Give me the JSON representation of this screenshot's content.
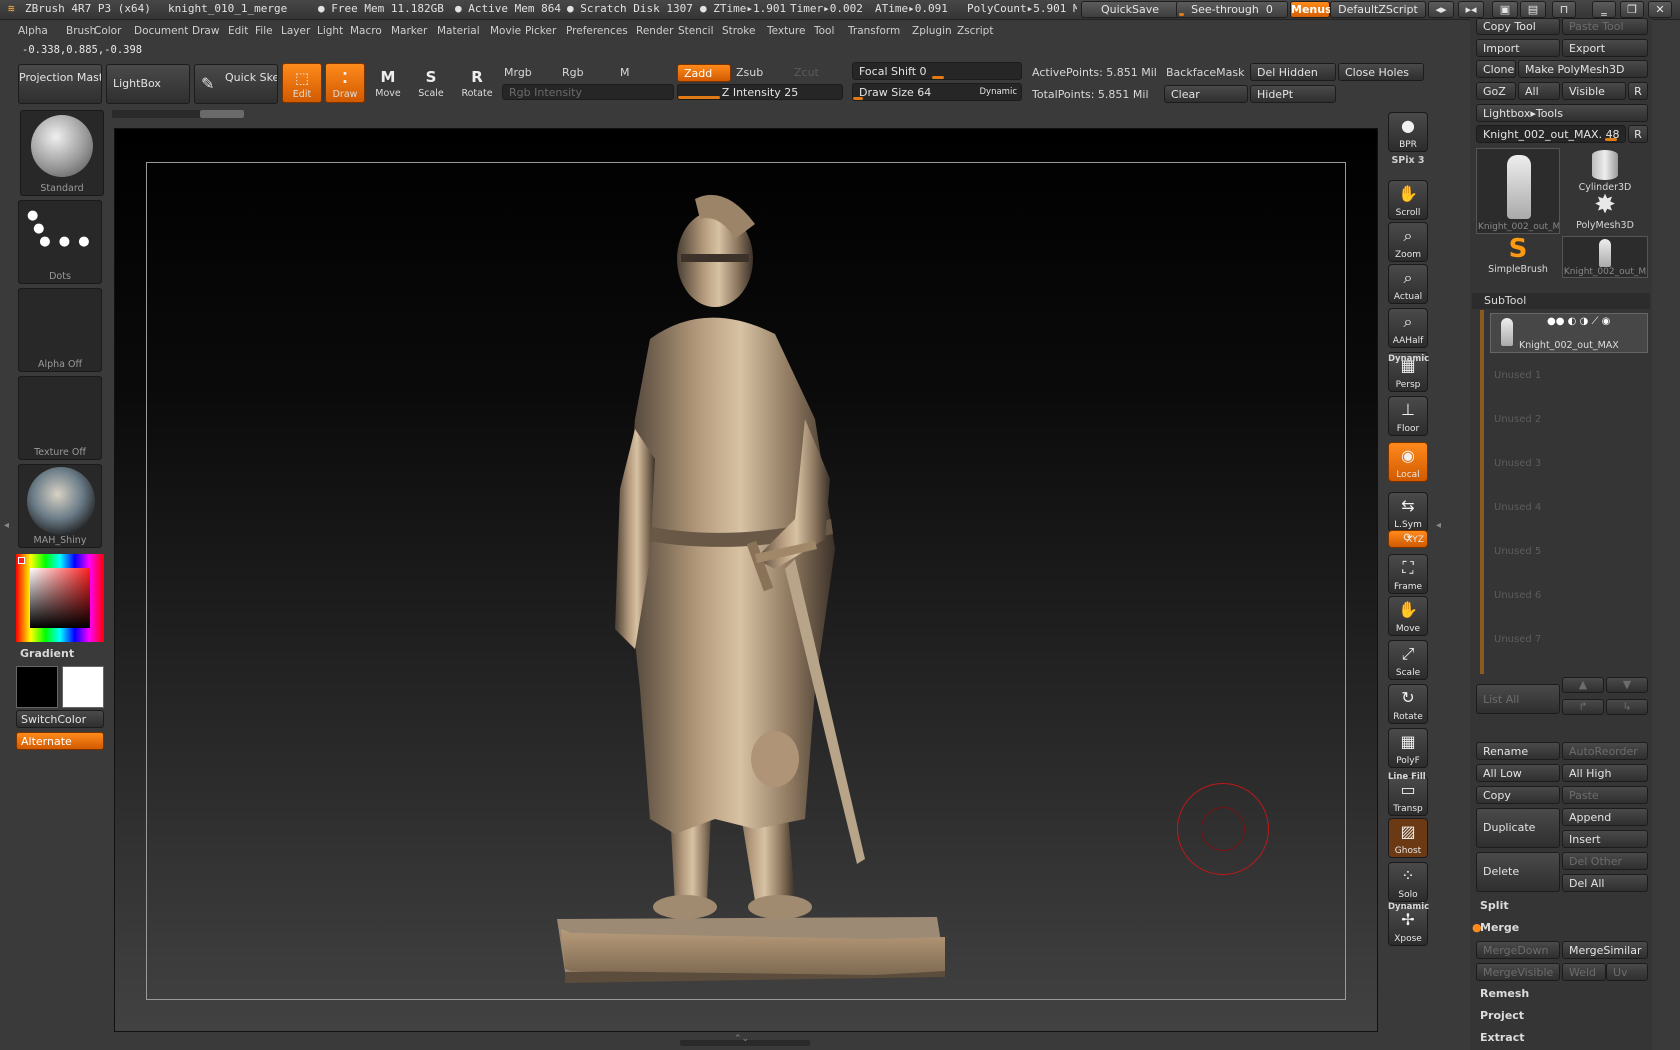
{
  "titlebar": {
    "app": "ZBrush 4R7 P3 (x64)",
    "document": "knight_010_1_merge",
    "free_mem": "● Free Mem 11.182GB",
    "active_mem": "● Active Mem 864",
    "scratch": "● Scratch Disk 1307",
    "ztime": "● ZTime▸1.901",
    "timer": "Timer▸0.002",
    "atime": "ATime▸0.091",
    "polycount": "PolyCount▸5.901 M",
    "quicksave": "QuickSave",
    "see_through_label": "See-through",
    "see_through_value": "0",
    "see_through_fraction": 0.05,
    "menus": "Menus",
    "script": "DefaultZScript"
  },
  "menubar": [
    "Alpha",
    "Brush",
    "Color",
    "Document",
    "Draw",
    "Edit",
    "File",
    "Layer",
    "Light",
    "Macro",
    "Marker",
    "Material",
    "Movie",
    "Picker",
    "Preferences",
    "Render",
    "Stencil",
    "Stroke",
    "Texture",
    "Tool",
    "Transform",
    "Zplugin",
    "Zscript"
  ],
  "coords": "-0.338,0.885,-0.398",
  "toolbar": {
    "projection_master": "Projection Master",
    "lightbox": "LightBox",
    "quick_sketch": "Quick Sketch",
    "edit": "Edit",
    "draw": "Draw",
    "move": "Move",
    "scale": "Scale",
    "rotate": "Rotate",
    "mrgb": "Mrgb",
    "rgb": "Rgb",
    "m": "M",
    "rgb_intensity": "Rgb Intensity",
    "zadd": "Zadd",
    "zsub": "Zsub",
    "zcut": "Zcut",
    "z_intensity": "Z Intensity 25",
    "z_intensity_fraction": 0.25,
    "focal_shift": "Focal Shift 0",
    "focal_shift_fraction": 0.5,
    "draw_size": "Draw Size 64",
    "draw_size_fraction": 0.06,
    "dynamic": "Dynamic",
    "active_points": "ActivePoints: 5.851 Mil",
    "total_points": "TotalPoints: 5.851 Mil",
    "backface_mask": "BackfaceMask",
    "del_hidden": "Del Hidden",
    "close_holes": "Close Holes",
    "clear": "Clear",
    "hidept": "HidePt"
  },
  "leftpanel": {
    "brush": "Standard",
    "stroke": "Dots",
    "alpha": "Alpha Off",
    "texture": "Texture Off",
    "material": "MAH_Shiny",
    "gradient": "Gradient",
    "switchcolor": "SwitchColor",
    "alternate": "Alternate",
    "main_color": "#000000",
    "secondary_color": "#ffffff"
  },
  "righttools": [
    {
      "name": "bpr",
      "label": "BPR",
      "icon": "bpr-sphere-icon",
      "state": "normal"
    },
    {
      "name": "spix",
      "label": "SPix 3",
      "icon": "",
      "state": "label"
    },
    {
      "name": "scroll",
      "label": "Scroll",
      "icon": "hand-icon",
      "state": "normal"
    },
    {
      "name": "zoom",
      "label": "Zoom",
      "icon": "magnifier-icon",
      "state": "normal"
    },
    {
      "name": "actual",
      "label": "Actual",
      "icon": "magnifier-icon",
      "state": "normal"
    },
    {
      "name": "aahalf",
      "label": "AAHalf",
      "icon": "magnifier-icon",
      "state": "normal"
    },
    {
      "name": "persp",
      "label": "Persp",
      "icon": "grid-icon",
      "state": "normal"
    },
    {
      "name": "floor",
      "label": "Floor",
      "icon": "floor-icon",
      "state": "normal"
    },
    {
      "name": "local",
      "label": "Local",
      "icon": "local-icon",
      "state": "active"
    },
    {
      "name": "lsym",
      "label": "L.Sym",
      "icon": "arrows-icon",
      "state": "normal"
    },
    {
      "name": "xyz",
      "label": "XYZ",
      "icon": "xyz-icon",
      "state": "active"
    },
    {
      "name": "frame",
      "label": "Frame",
      "icon": "frame-icon",
      "state": "normal"
    },
    {
      "name": "move",
      "label": "Move",
      "icon": "hand-icon",
      "state": "normal"
    },
    {
      "name": "scale",
      "label": "Scale",
      "icon": "scale-icon",
      "state": "normal"
    },
    {
      "name": "rotate",
      "label": "Rotate",
      "icon": "rotate-icon",
      "state": "normal"
    },
    {
      "name": "polyf",
      "label": "PolyF",
      "icon": "grid-icon",
      "state": "normal"
    },
    {
      "name": "transp",
      "label": "Transp",
      "icon": "transp-icon",
      "state": "normal"
    },
    {
      "name": "ghost",
      "label": "Ghost",
      "icon": "ghost-icon",
      "state": "brown"
    },
    {
      "name": "solo",
      "label": "Solo",
      "icon": "spheres-icon",
      "state": "normal"
    },
    {
      "name": "xpose",
      "label": "Xpose",
      "icon": "xpose-icon",
      "state": "normal"
    }
  ],
  "rightextra": {
    "dynamic1": "Dynamic",
    "line_fill": "Line Fill",
    "dynamic2": "Dynamic"
  },
  "rpanel": {
    "copy_tool": "Copy Tool",
    "paste_tool": "Paste Tool",
    "import": "Import",
    "export": "Export",
    "clone": "Clone",
    "make_polymesh": "Make PolyMesh3D",
    "goz": "GoZ",
    "all": "All",
    "visible": "Visible",
    "r": "R",
    "lightbox_tools": "Lightbox▸Tools",
    "current_tool": "Knight_002_out_MAX. 48",
    "tool_thumbs": [
      {
        "name": "Knight_002_out_M",
        "icon": "knight-icon"
      },
      {
        "name": "Cylinder3D",
        "icon": "cylinder-icon"
      },
      {
        "name": "PolyMesh3D",
        "icon": "star-icon"
      },
      {
        "name": "SimpleBrush",
        "icon": "simplebrush-icon"
      },
      {
        "name": "Knight_002_out_M",
        "icon": "knight-icon"
      }
    ],
    "subtool_header": "SubTool",
    "subtool_active": "Knight_002_out_MAX",
    "unused": [
      "Unused 1",
      "Unused 2",
      "Unused 3",
      "Unused 4",
      "Unused 5",
      "Unused 6",
      "Unused 7"
    ],
    "list_all": "List All",
    "rename": "Rename",
    "autoreorder": "AutoReorder",
    "all_low": "All Low",
    "all_high": "All High",
    "copy": "Copy",
    "paste": "Paste",
    "duplicate": "Duplicate",
    "append": "Append",
    "insert": "Insert",
    "delete": "Delete",
    "del_other": "Del Other",
    "del_all": "Del All",
    "split": "Split",
    "merge": "Merge",
    "mergedown": "MergeDown",
    "mergesimilar": "MergeSimilar",
    "mergevisible": "MergeVisible",
    "weld": "Weld",
    "uv": "Uv",
    "remesh": "Remesh",
    "project": "Project",
    "extract": "Extract"
  }
}
